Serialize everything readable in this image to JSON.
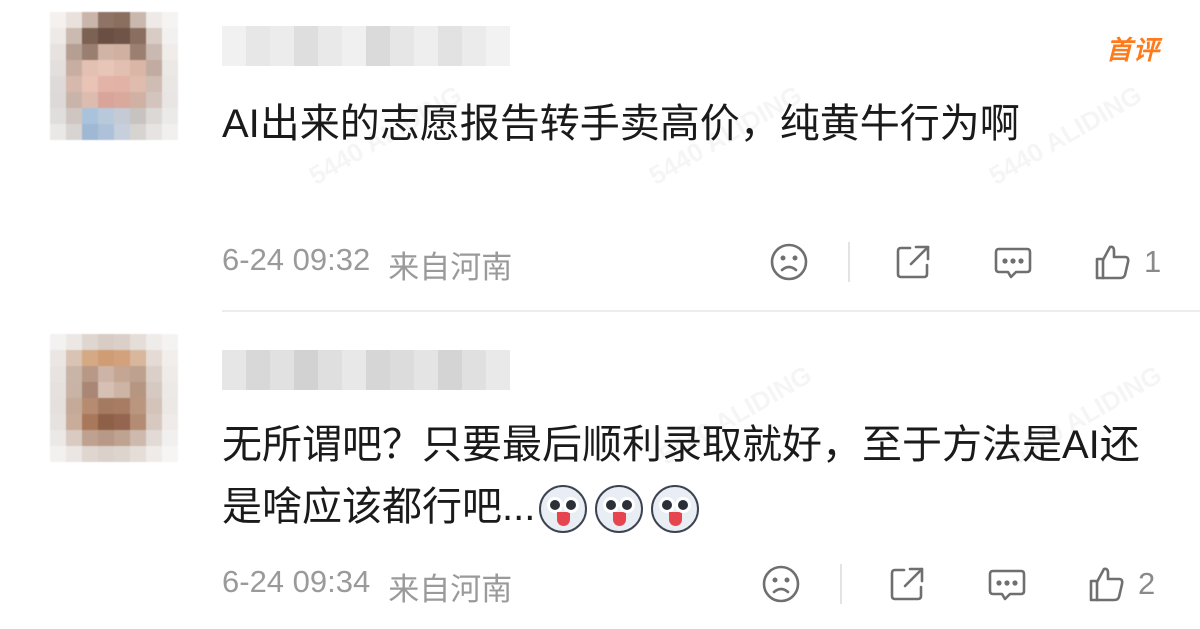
{
  "header": {
    "badge": "首评"
  },
  "watermark": {
    "text": "5440 ALIDING"
  },
  "comments": [
    {
      "text": "AI出来的志愿报告转手卖高价，纯黄牛行为啊",
      "date": "6-24 09:32",
      "location": "来自河南",
      "likes": "1",
      "icons": [
        "sad-face-icon",
        "share-icon",
        "comment-icon",
        "thumbs-up-icon"
      ]
    },
    {
      "text": "无所谓吧？只要最后顺利录取就好，至于方法是AI还是啥应该都行吧...",
      "emojis": [
        "husky-emoji",
        "husky-emoji",
        "husky-emoji"
      ],
      "date": "6-24 09:34",
      "location": "来自河南",
      "likes": "2",
      "icons": [
        "sad-face-icon",
        "share-icon",
        "comment-icon",
        "thumbs-up-icon"
      ]
    }
  ],
  "colors": {
    "accent": "#ff7a1a",
    "meta": "#9a9a9a",
    "text": "#1a1a1a"
  }
}
